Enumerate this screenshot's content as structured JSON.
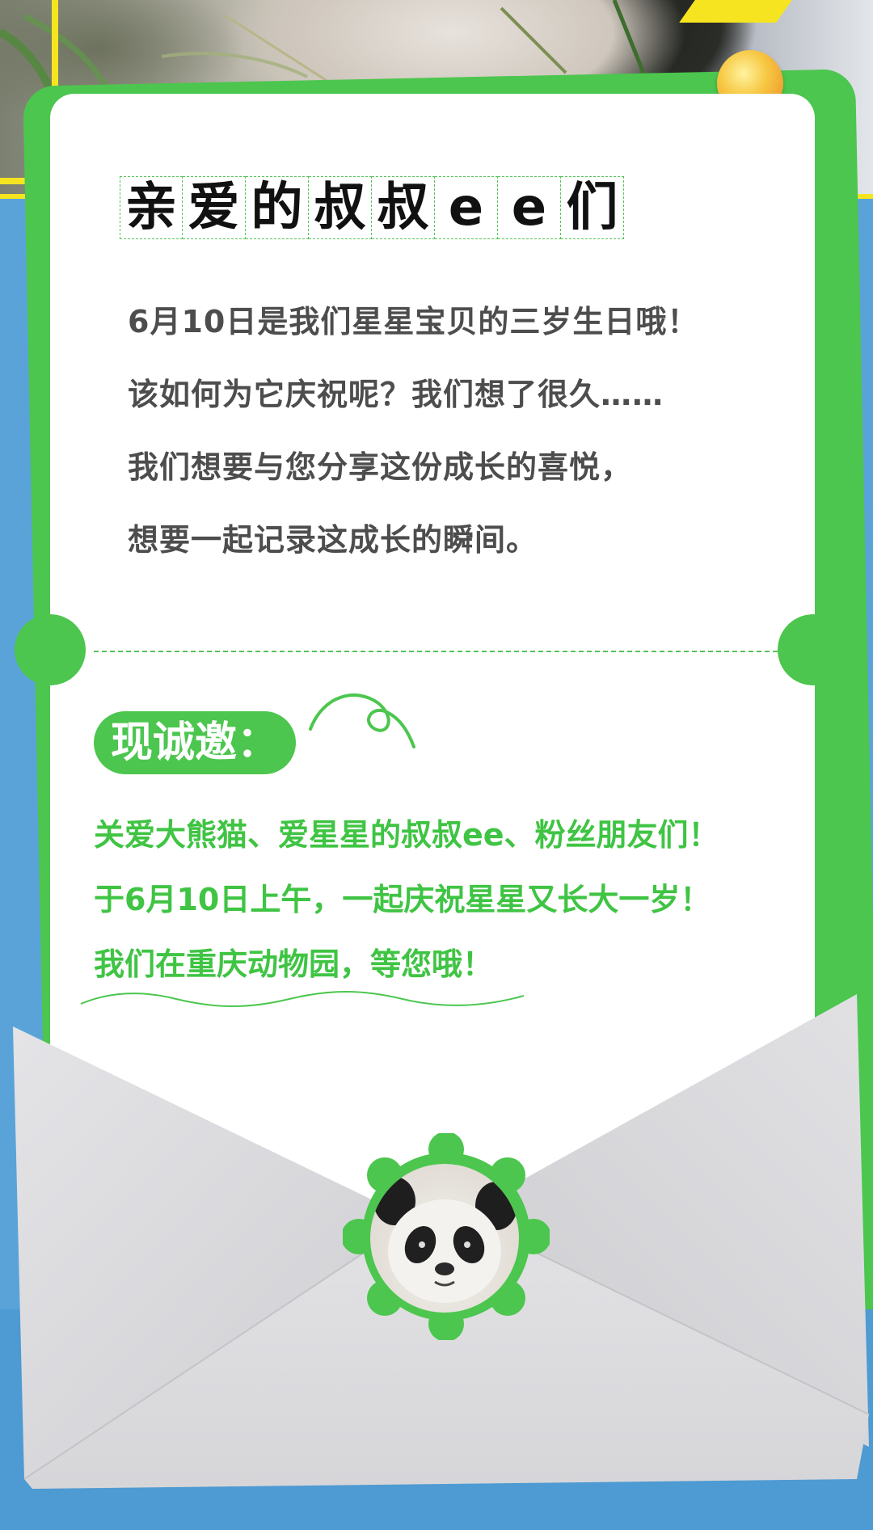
{
  "colors": {
    "sky_blue": "#5aa3d8",
    "green": "#4cc64e",
    "text_gray": "#4d4d4d",
    "invite_green": "#3fc443",
    "envelope_gray": "#dcdcdf",
    "yellow": "#f6e420"
  },
  "images": {
    "top_photo": "panda-eating-bamboo-photo",
    "stamp_photo": "panda-face-photo"
  },
  "heading": {
    "chars": [
      "亲",
      "爱",
      "的",
      "叔",
      "叔",
      "e",
      "e",
      "们"
    ]
  },
  "intro": {
    "lines": [
      "6月10日是我们星星宝贝的三岁生日哦！",
      "该如何为它庆祝呢？我们想了很久……",
      "我们想要与您分享这份成长的喜悦，",
      "想要一起记录这成长的瞬间。"
    ]
  },
  "invite": {
    "label": "现诚邀：",
    "lines": [
      "关爱大熊猫、爱星星的叔叔ee、粉丝朋友们！",
      "于6月10日上午，一起庆祝星星又长大一岁！",
      "我们在重庆动物园，等您哦！"
    ]
  }
}
